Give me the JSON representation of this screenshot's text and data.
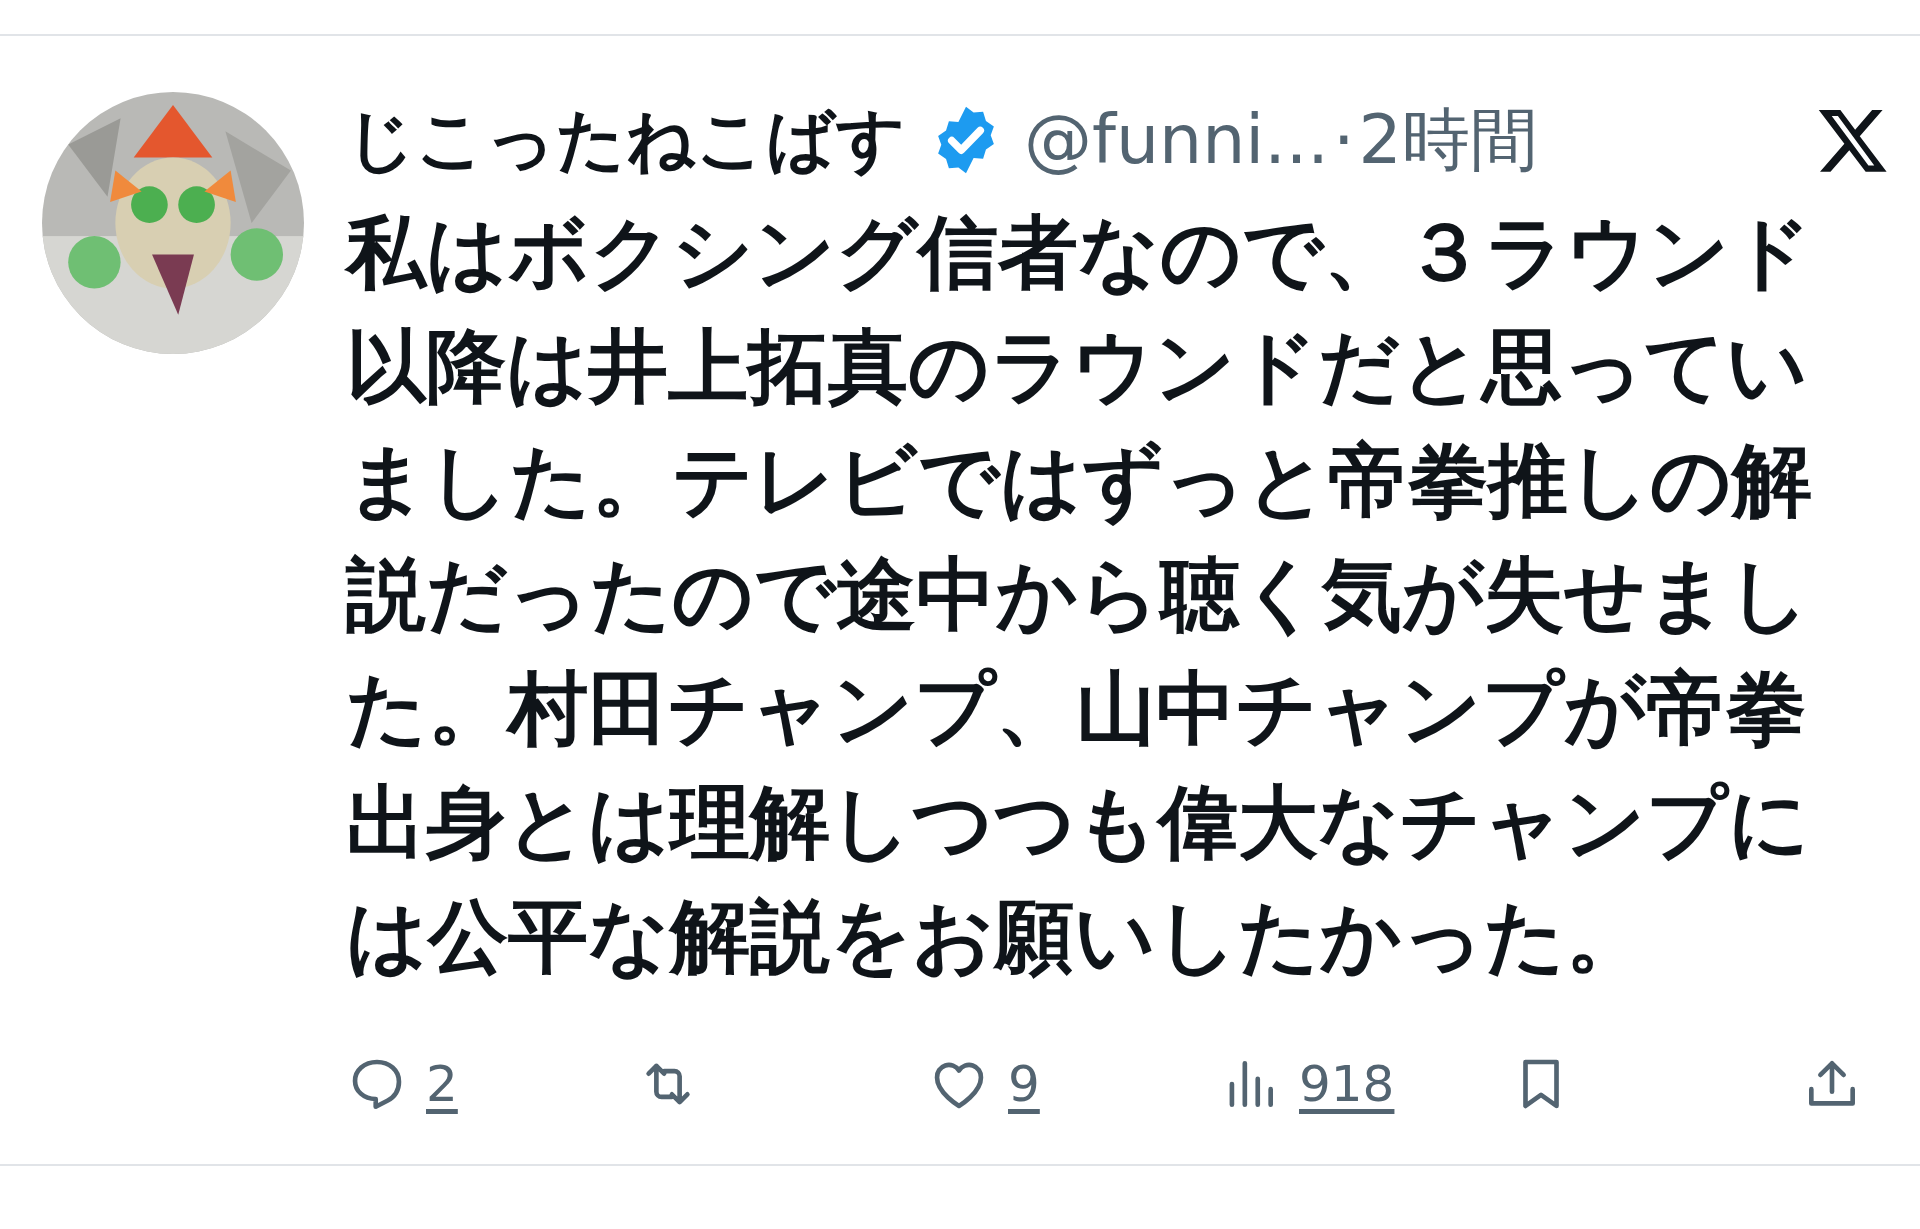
{
  "tweet": {
    "display_name": "じこったねこばす",
    "verified": true,
    "handle": "@funni...",
    "separator": "·",
    "time": "2時間",
    "text": "私はボクシング信者なので、３ラウンド以降は井上拓真のラウンドだと思っていました。テレビではずっと帝拳推しの解説だったので途中から聴く気が失せました。村田チャンプ、山中チャンプが帝拳出身とは理解しつつも偉大なチャンプには公平な解説をお願いしたかった。",
    "actions": [
      {
        "kind": "reply",
        "count": "2"
      },
      {
        "kind": "repost"
      },
      {
        "kind": "like",
        "count": "9"
      },
      {
        "kind": "views",
        "count": "918"
      },
      {
        "kind": "bookmark"
      },
      {
        "kind": "share"
      }
    ]
  }
}
